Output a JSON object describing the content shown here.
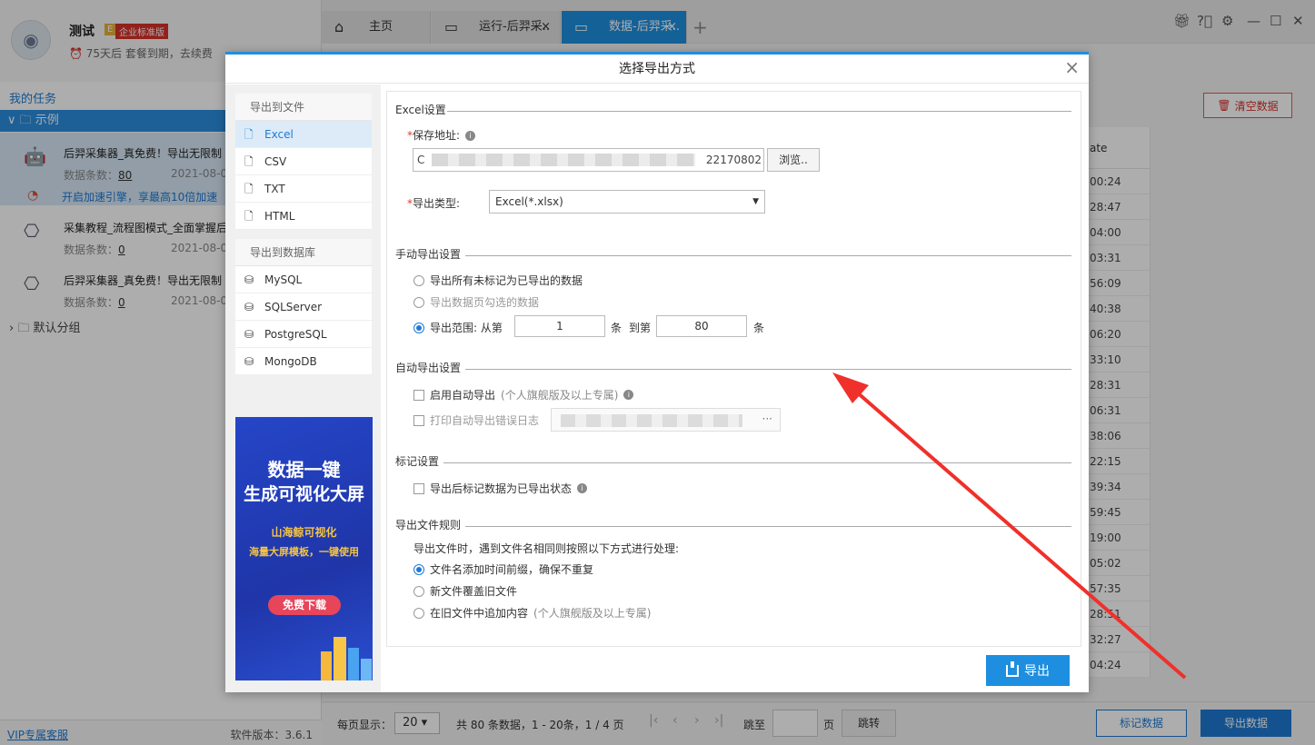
{
  "left": {
    "username": "测试",
    "badge_e": "E",
    "edition": "企业标准版",
    "expire": "75天后 套餐到期，去续费",
    "my_tasks": "我的任务",
    "group_example": "示例",
    "tasks": [
      {
        "title": "后羿采集器_真免费！导出无限制",
        "count_label": "数据条数：",
        "count": "80",
        "date": "2021-08-09",
        "accel": "开启加速引擎，享最高10倍加速"
      },
      {
        "title": "采集教程_流程图模式_全面掌握后",
        "count_label": "数据条数：",
        "count": "0",
        "date": "2021-08-09"
      },
      {
        "title": "后羿采集器_真免费！导出无限制",
        "count_label": "数据条数：",
        "count": "0",
        "date": "2021-08-09"
      }
    ],
    "default_group": "默认分组",
    "vip": "VIP专属客服",
    "version": "软件版本：3.6.1"
  },
  "tabs": [
    {
      "label": "主页"
    },
    {
      "label": "运行-后羿采.."
    },
    {
      "label": "数据-后羿采.."
    }
  ],
  "tab_close": "×",
  "tab_add": "+",
  "clear_btn": "清空数据",
  "data_column": {
    "header": "ate",
    "cells": [
      ":00:24",
      ":28:47",
      ":04:00",
      ":03:31",
      ":56:09",
      ":40:38",
      ":06:20",
      ":33:10",
      ":28:31",
      ":06:31",
      ":38:06",
      ":22:15",
      ":39:34",
      ":59:45",
      ":19:00",
      ":05:02",
      ":57:35",
      ":28:51",
      ":32:27",
      ":04:24"
    ]
  },
  "pager": {
    "per_page_label": "每页显示：",
    "per_page": "20",
    "summary": "共 80 条数据，1 - 20条，1 / 4 页",
    "goto": "跳至",
    "page": "页",
    "jump": "跳转",
    "mark": "标记数据",
    "export_data": "导出数据"
  },
  "modal": {
    "title": "选择导出方式",
    "close": "×",
    "file_group": "导出到文件",
    "file_items": [
      "Excel",
      "CSV",
      "TXT",
      "HTML"
    ],
    "db_group": "导出到数据库",
    "db_items": [
      "MySQL",
      "SQLServer",
      "PostgreSQL",
      "MongoDB"
    ],
    "ad": {
      "line1": "数据一键",
      "line2": "生成可视化大屏",
      "line3": "山海鲸可视化",
      "line4": "海量大屏模板，一键使用",
      "button": "免费下载"
    },
    "excel_section": "Excel设置",
    "save_path_label": "保存地址:",
    "save_path_start": "C",
    "save_path_tail": "22170802",
    "browse": "浏览..",
    "type_label": "导出类型:",
    "type_value": "Excel(*.xlsx)",
    "manual_section": "手动导出设置",
    "manual_opt1": "导出所有未标记为已导出的数据",
    "manual_opt2": "导出数据页勾选的数据",
    "manual_opt3": "导出范围:",
    "from_label": "从第",
    "range_from": "1",
    "unit1": "条",
    "to_label": "到第",
    "range_to": "80",
    "unit2": "条",
    "auto_section": "自动导出设置",
    "auto_opt1": "启用自动导出",
    "auto_opt1_hint": "(个人旗舰版及以上专属)",
    "auto_opt2": "打印自动导出错误日志",
    "log_dots": "···",
    "mark_section": "标记设置",
    "mark_opt": "导出后标记数据为已导出状态",
    "rule_section": "导出文件规则",
    "rule_desc": "导出文件时，遇到文件名相同则按照以下方式进行处理:",
    "rule_opt1": "文件名添加时间前缀，确保不重复",
    "rule_opt2": "新文件覆盖旧文件",
    "rule_opt3": "在旧文件中追加内容",
    "rule_opt3_hint": "(个人旗舰版及以上专属)",
    "export_btn": "导出"
  }
}
